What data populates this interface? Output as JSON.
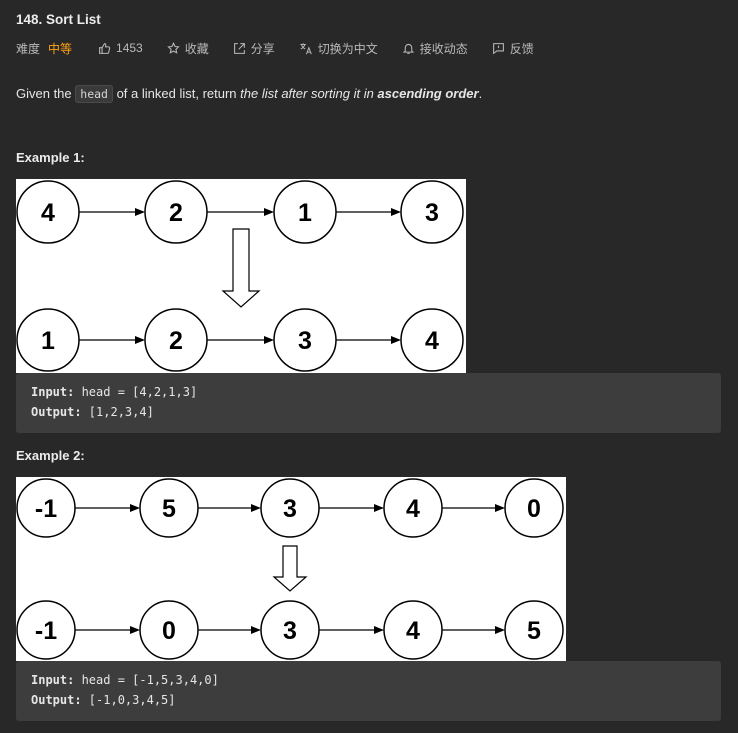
{
  "problem": {
    "title": "148. Sort List",
    "difficulty_label": "难度",
    "difficulty": "中等",
    "likes": "1453",
    "favorite": "收藏",
    "share": "分享",
    "translate": "切换为中文",
    "subscribe": "接收动态",
    "feedback": "反馈"
  },
  "description": {
    "part1": "Given the ",
    "code": "head",
    "part2": " of a linked list, return ",
    "italic": "the list after sorting it in ",
    "bold_italic": "ascending order",
    "end": "."
  },
  "examples": [
    {
      "title": "Example 1:",
      "before": [
        "4",
        "2",
        "1",
        "3"
      ],
      "after": [
        "1",
        "2",
        "3",
        "4"
      ],
      "input_label": "Input:",
      "input_value": " head = [4,2,1,3]",
      "output_label": "Output:",
      "output_value": " [1,2,3,4]"
    },
    {
      "title": "Example 2:",
      "before": [
        "-1",
        "5",
        "3",
        "4",
        "0"
      ],
      "after": [
        "-1",
        "0",
        "3",
        "4",
        "5"
      ],
      "input_label": "Input:",
      "input_value": " head = [-1,5,3,4,0]",
      "output_label": "Output:",
      "output_value": " [-1,0,3,4,5]"
    }
  ],
  "colors": {
    "background": "#282828",
    "difficulty": "#ffa116",
    "code_block": "#3d3d3d"
  }
}
